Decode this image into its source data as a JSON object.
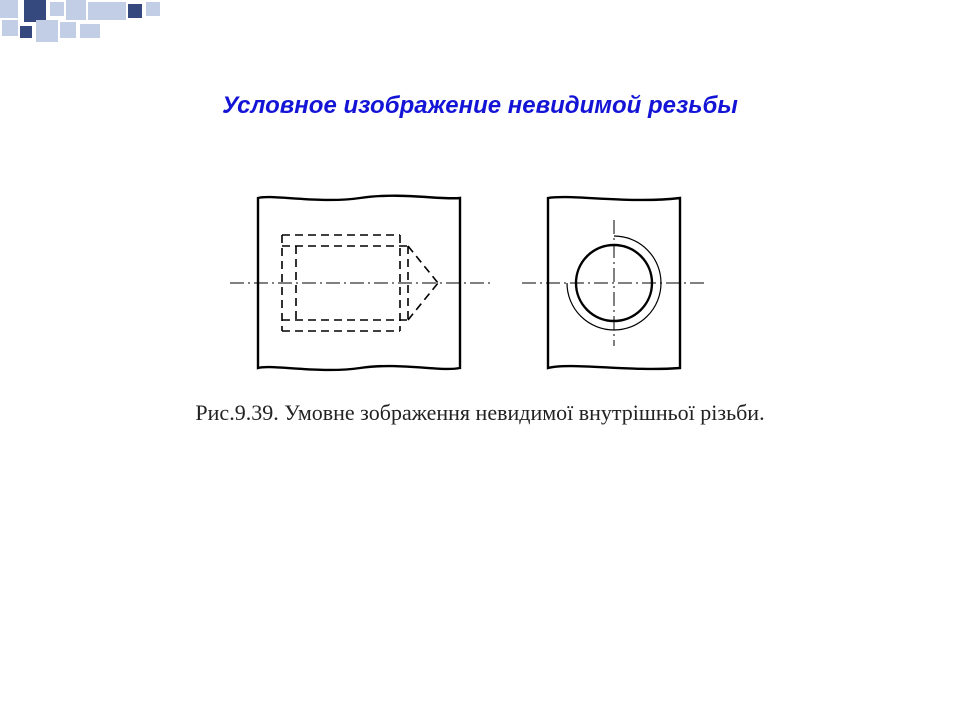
{
  "title": "Условное изображение невидимой резьбы",
  "caption": "Рис.9.39. Умовне зображення невидимої внутрішньої різьби.",
  "decor": {
    "dark": "#35497e",
    "light": "#c2cde6"
  },
  "drawing": {
    "stroke": "#000000",
    "thin": 1,
    "thick": 2.4
  }
}
